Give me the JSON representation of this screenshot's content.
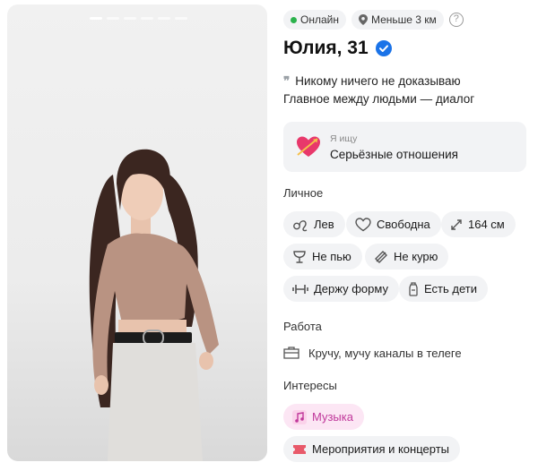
{
  "status": {
    "online": "Онлайн",
    "distance": "Меньше 3 км",
    "help": "?"
  },
  "profile": {
    "name_age": "Юлия, 31"
  },
  "about": {
    "line1": "Никому ничего не доказываю",
    "line2": "Главное между людьми — диалог"
  },
  "looking_for": {
    "label": "Я ищу",
    "value": "Серьёзные отношения"
  },
  "personal": {
    "title": "Личное",
    "chips": {
      "zodiac": "Лев",
      "relationship": "Свободна",
      "height": "164 см",
      "drinking": "Не пью",
      "smoking": "Не курю",
      "fitness": "Держу форму",
      "kids": "Есть дети"
    }
  },
  "work": {
    "title": "Работа",
    "value": "Кручу, мучу каналы в телеге"
  },
  "interests": {
    "title": "Интересы",
    "items": [
      "Музыка",
      "Мероприятия и концерты"
    ]
  },
  "colors": {
    "online": "#2bb24c",
    "verified": "#1a73e8",
    "interest_pink": "#c0389b"
  },
  "photo": {
    "pages": 6,
    "active_page": 1
  }
}
